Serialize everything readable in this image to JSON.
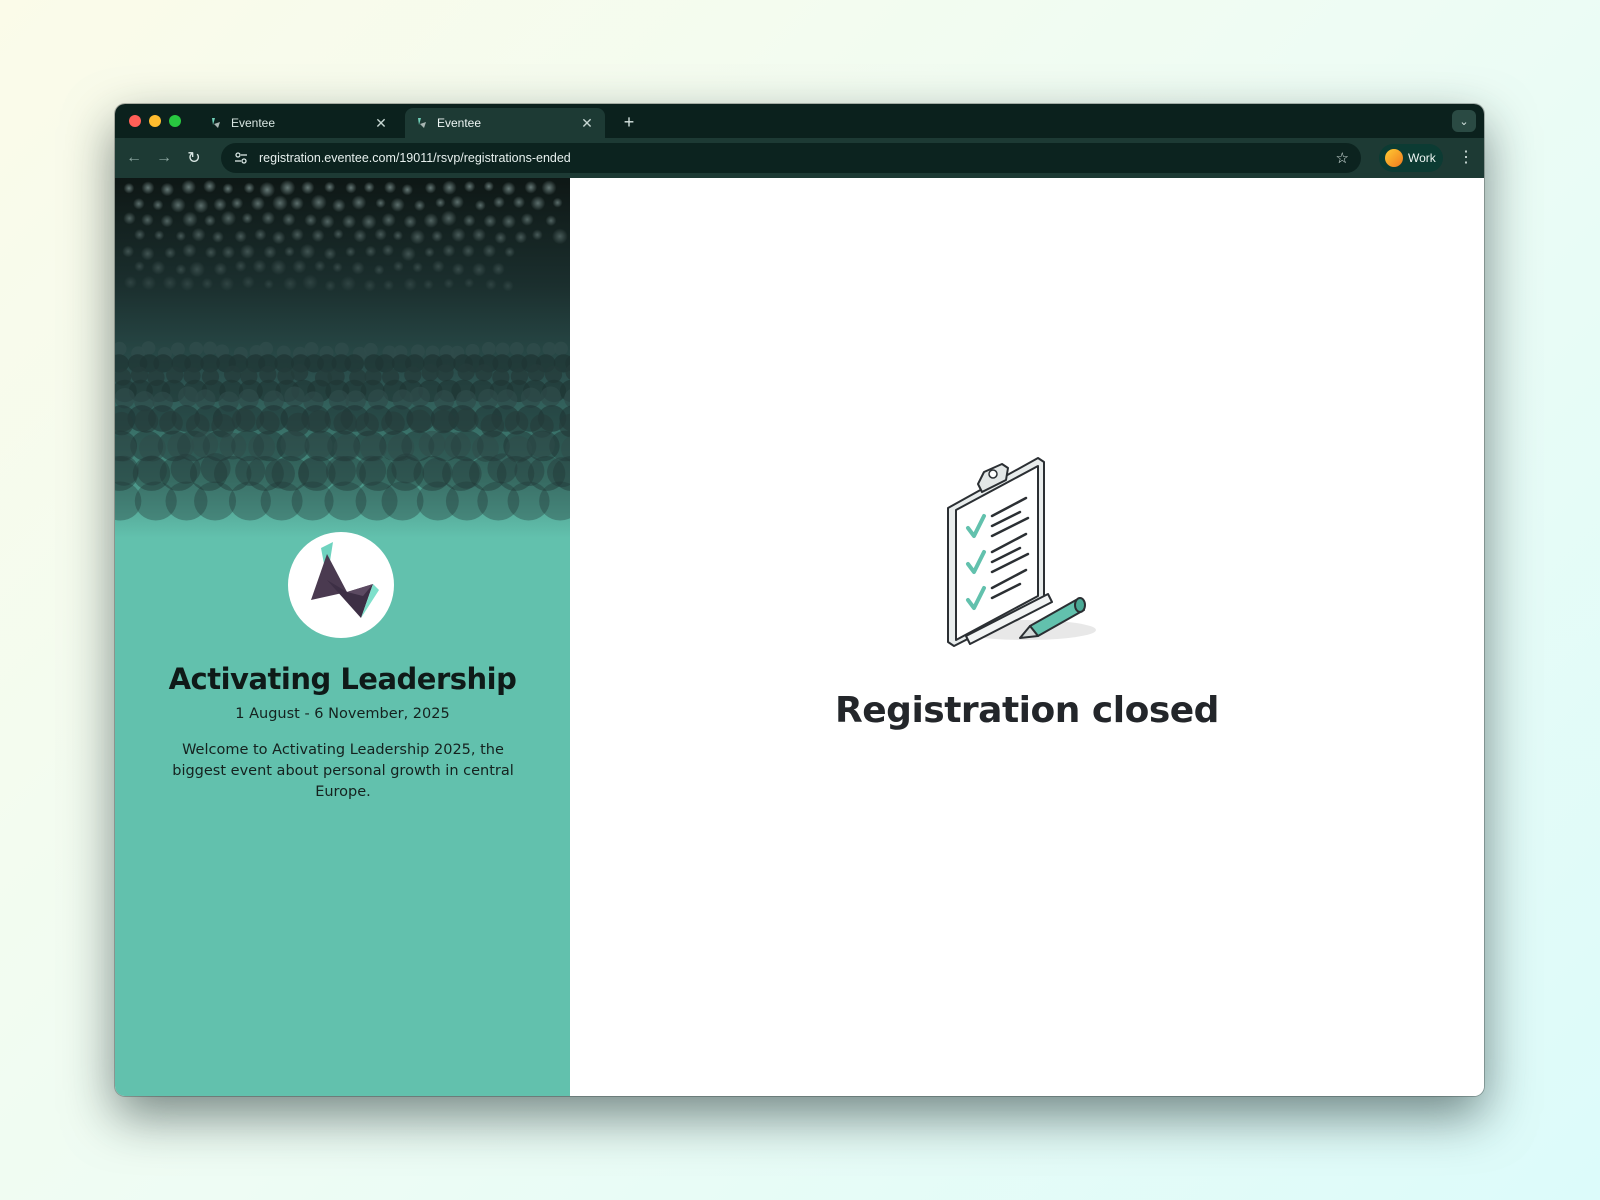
{
  "browser": {
    "tabs": [
      {
        "title": "Eventee",
        "active": false
      },
      {
        "title": "Eventee",
        "active": true
      }
    ],
    "new_tab_label": "+",
    "url": "registration.eventee.com/19011/rsvp/registrations-ended",
    "profile_name": "Work"
  },
  "event": {
    "title": "Activating Leadership",
    "dates": "1 August - 6 November, 2025",
    "description": "Welcome to Activating Leadership 2025, the biggest event about personal growth in central Europe."
  },
  "main": {
    "status_title": "Registration closed"
  },
  "colors": {
    "accent": "#62c1ad",
    "browser_chrome": "#0b211d",
    "toolbar": "#1d3a34"
  }
}
